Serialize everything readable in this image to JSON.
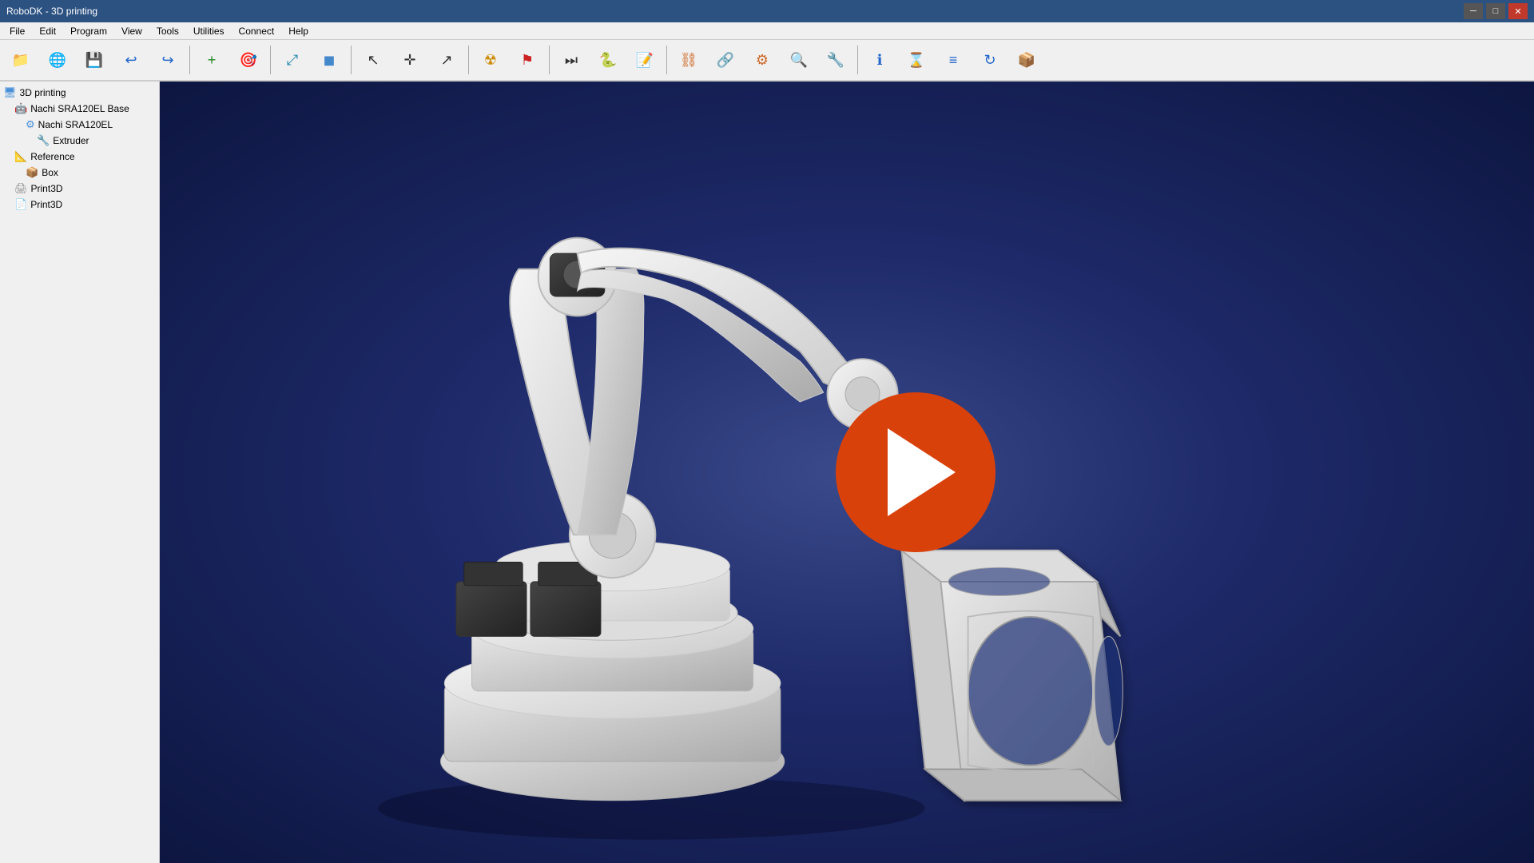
{
  "title_bar": {
    "title": "RoboDK - 3D printing",
    "minimize_label": "─",
    "maximize_label": "□",
    "close_label": "✕"
  },
  "menu": {
    "items": [
      "File",
      "Edit",
      "Program",
      "View",
      "Tools",
      "Utilities",
      "Connect",
      "Help"
    ]
  },
  "toolbar": {
    "buttons": [
      {
        "name": "open-file-btn",
        "icon": "📁",
        "tooltip": "Open File",
        "class": "ico-folder"
      },
      {
        "name": "open-online-btn",
        "icon": "🌐",
        "tooltip": "Open Online",
        "class": "ico-globe"
      },
      {
        "name": "save-btn",
        "icon": "💾",
        "tooltip": "Save",
        "class": "ico-save"
      },
      {
        "name": "undo-btn",
        "icon": "↩",
        "tooltip": "Undo",
        "class": "ico-undo"
      },
      {
        "name": "redo-btn",
        "icon": "↪",
        "tooltip": "Redo",
        "class": "ico-redo"
      },
      {
        "name": "sep1",
        "type": "separator"
      },
      {
        "name": "add-object-btn",
        "icon": "+",
        "tooltip": "Add Object",
        "class": "ico-add"
      },
      {
        "name": "add-target-btn",
        "icon": "🎯",
        "tooltip": "Add Target",
        "class": "ico-target"
      },
      {
        "name": "sep2",
        "type": "separator"
      },
      {
        "name": "fit-view-btn",
        "icon": "⤢",
        "tooltip": "Fit All",
        "class": "ico-move"
      },
      {
        "name": "perspective-btn",
        "icon": "◼",
        "tooltip": "Perspective",
        "class": "ico-cube"
      },
      {
        "name": "sep3",
        "type": "separator"
      },
      {
        "name": "select-btn",
        "icon": "↖",
        "tooltip": "Select",
        "class": "ico-cursor"
      },
      {
        "name": "move-btn",
        "icon": "✛",
        "tooltip": "Move",
        "class": "ico-cursor"
      },
      {
        "name": "rotate-btn",
        "icon": "↗",
        "tooltip": "Rotate",
        "class": "ico-cursor"
      },
      {
        "name": "sep4",
        "type": "separator"
      },
      {
        "name": "radiation-btn",
        "icon": "☢",
        "tooltip": "Collision",
        "class": "ico-radiation"
      },
      {
        "name": "flag-btn",
        "icon": "⚑",
        "tooltip": "Flag",
        "class": "ico-flag"
      },
      {
        "name": "sep5",
        "type": "separator"
      },
      {
        "name": "ff-btn",
        "icon": "⏭",
        "tooltip": "Fast Forward",
        "class": "ico-ff"
      },
      {
        "name": "python-btn",
        "icon": "🐍",
        "tooltip": "Python Script",
        "class": "ico-python"
      },
      {
        "name": "add-prog-btn",
        "icon": "📝",
        "tooltip": "Add Program",
        "class": "ico-note"
      },
      {
        "name": "sep6",
        "type": "separator"
      },
      {
        "name": "link1-btn",
        "icon": "⛓",
        "tooltip": "Link",
        "class": "ico-link"
      },
      {
        "name": "link2-btn",
        "icon": "🔗",
        "tooltip": "Link2",
        "class": "ico-link"
      },
      {
        "name": "link3-btn",
        "icon": "⚙",
        "tooltip": "Settings",
        "class": "ico-link"
      },
      {
        "name": "search-btn",
        "icon": "🔍",
        "tooltip": "Search",
        "class": "ico-link"
      },
      {
        "name": "tool-btn",
        "icon": "🔧",
        "tooltip": "Tool",
        "class": "ico-link"
      },
      {
        "name": "sep7",
        "type": "separator"
      },
      {
        "name": "info-btn",
        "icon": "ℹ",
        "tooltip": "Info",
        "class": "ico-info"
      },
      {
        "name": "timer-btn",
        "icon": "⌛",
        "tooltip": "Timer",
        "class": "ico-clock"
      },
      {
        "name": "layers-btn",
        "icon": "≡",
        "tooltip": "Layers",
        "class": "ico-layers"
      },
      {
        "name": "refresh-btn",
        "icon": "↻",
        "tooltip": "Refresh",
        "class": "ico-refresh"
      },
      {
        "name": "package-btn",
        "icon": "📦",
        "tooltip": "Package",
        "class": "ico-box"
      }
    ]
  },
  "scene_tree": {
    "items": [
      {
        "id": "item-3dprinting",
        "label": "3D printing",
        "indent": 0,
        "icon_type": "monitor",
        "icon_color": "#4a90d9"
      },
      {
        "id": "item-nachi-base",
        "label": "Nachi SRA120EL Base",
        "indent": 1,
        "icon_type": "robot",
        "icon_color": "#888"
      },
      {
        "id": "item-nachi-robot",
        "label": "Nachi SRA120EL",
        "indent": 2,
        "icon_type": "robot-arm",
        "icon_color": "#4a90d9"
      },
      {
        "id": "item-extruder",
        "label": "Extruder",
        "indent": 3,
        "icon_type": "tool",
        "icon_color": "#ddaa00"
      },
      {
        "id": "item-reference",
        "label": "Reference",
        "indent": 1,
        "icon_type": "reference",
        "icon_color": "#22cc44"
      },
      {
        "id": "item-box",
        "label": "Box",
        "indent": 2,
        "icon_type": "box",
        "icon_color": "#4a90d9"
      },
      {
        "id": "item-print3d-1",
        "label": "Print3D",
        "indent": 1,
        "icon_type": "print",
        "icon_color": "#888"
      },
      {
        "id": "item-print3d-2",
        "label": "Print3D",
        "indent": 1,
        "icon_type": "print-white",
        "icon_color": "#fff"
      }
    ]
  },
  "viewport": {
    "play_button_visible": true,
    "background_gradient_start": "#3a4a8a",
    "background_gradient_end": "#0d1640"
  }
}
